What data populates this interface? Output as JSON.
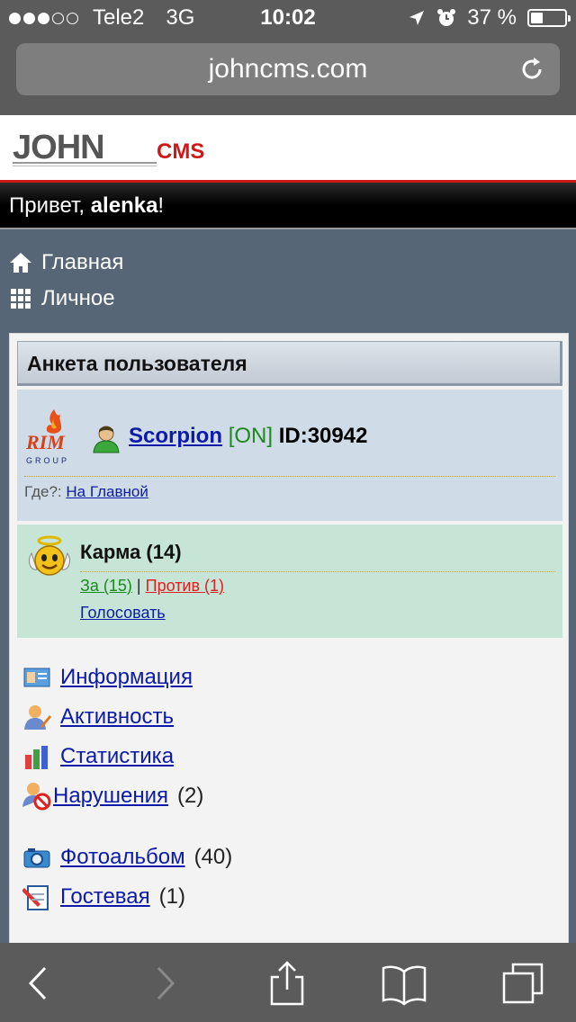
{
  "status": {
    "carrier": "Tele2",
    "network": "3G",
    "time": "10:02",
    "battery": "37 %",
    "battery_level": 0.37
  },
  "browser": {
    "url": "johncms.com"
  },
  "header": {
    "greeting_prefix": "Привет, ",
    "username": "alenka",
    "greeting_suffix": "!"
  },
  "nav": {
    "home": "Главная",
    "personal": "Личное"
  },
  "profile": {
    "title": "Анкета пользователя",
    "name": "Scorpion",
    "online": "[ON]",
    "id": "ID:30942",
    "where_label": "Где?:",
    "where_link": "На Главной"
  },
  "karma": {
    "title": "Карма (14)",
    "for": "За (15)",
    "separator": "|",
    "against": "Против (1)",
    "vote": "Голосовать"
  },
  "links": {
    "info": "Информация",
    "activity": "Активность",
    "stats": "Статистика",
    "violations": "Нарушения",
    "violations_count": "(2)",
    "album": "Фотоальбом",
    "album_count": "(40)",
    "guestbook": "Гостевая",
    "guestbook_count": "(1)"
  },
  "logo": {
    "main": "JOHN",
    "sub": "CMS",
    "rim": "RIM",
    "group": "GROUP"
  }
}
